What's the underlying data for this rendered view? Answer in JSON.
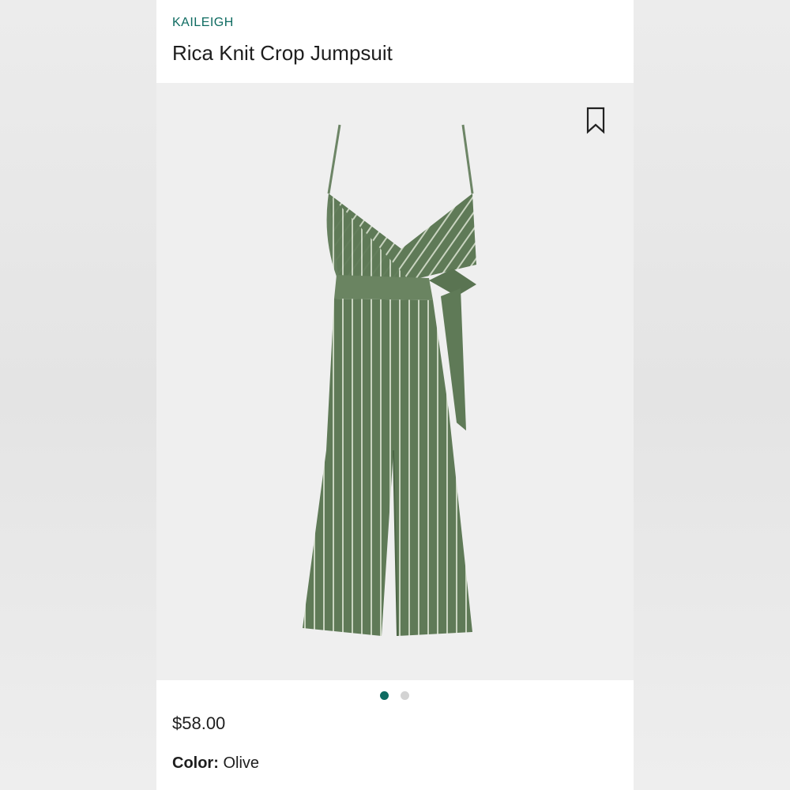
{
  "product": {
    "brand": "KAILEIGH",
    "title": "Rica Knit Crop Jumpsuit",
    "price": "$58.00",
    "color_label": "Color:",
    "color_value": "Olive"
  },
  "gallery": {
    "image_count": 2,
    "active_index": 0
  },
  "icons": {
    "bookmark": "bookmark-icon"
  },
  "colors": {
    "brand_accent": "#0e6b61",
    "garment": "#5f7a57",
    "stripe": "#c9d4c0",
    "dot_inactive": "#d3d3d3"
  }
}
